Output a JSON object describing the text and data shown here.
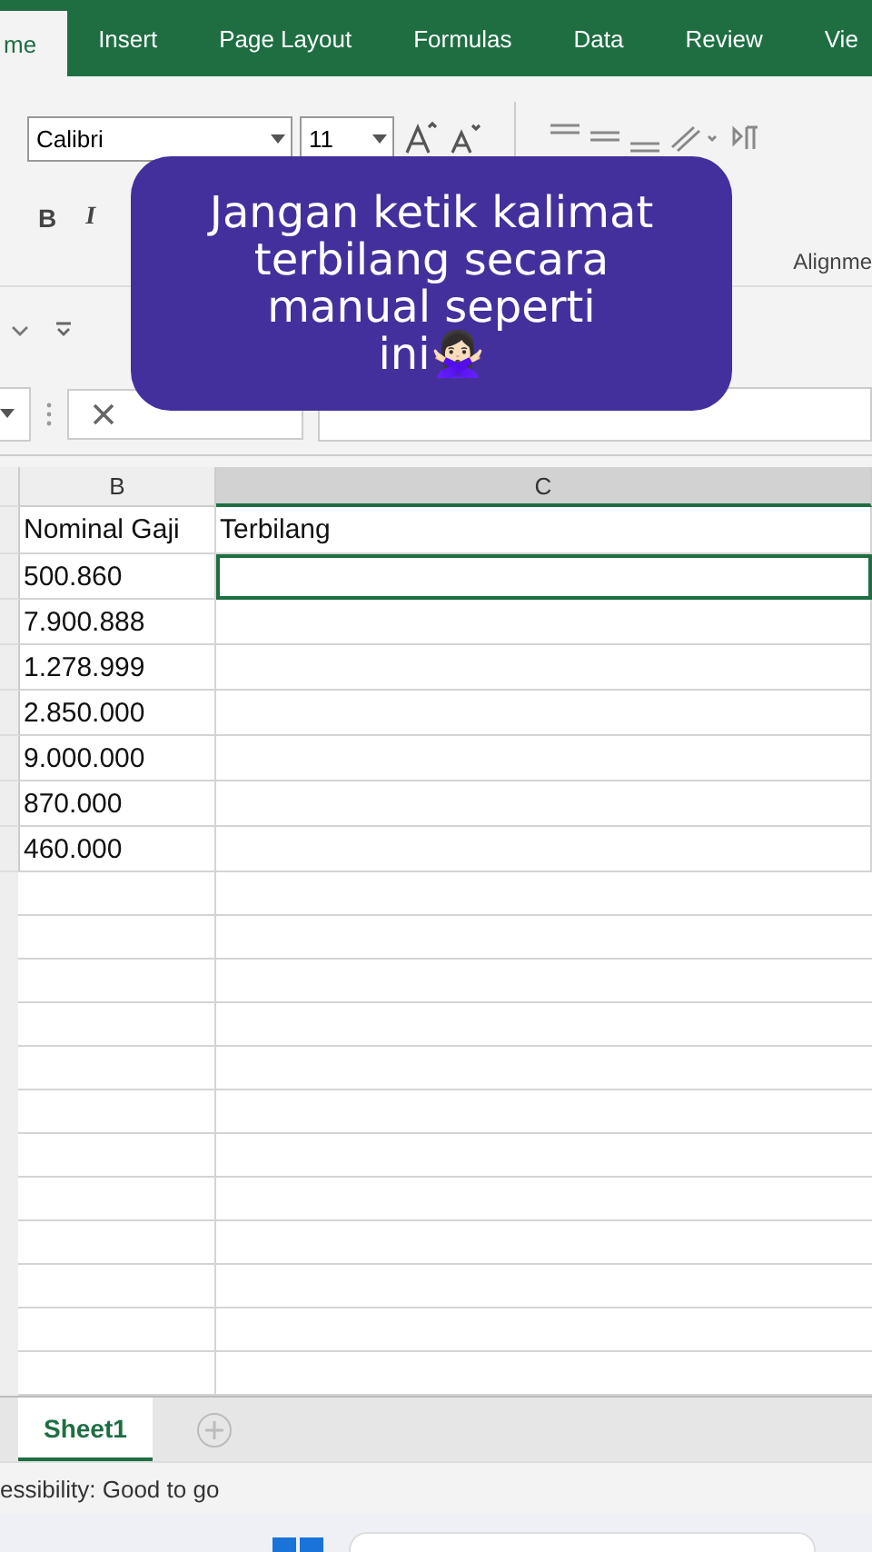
{
  "ribbon_tabs": [
    {
      "label": "me",
      "selected": true
    },
    {
      "label": "Insert",
      "selected": false
    },
    {
      "label": "Page Layout",
      "selected": false
    },
    {
      "label": "Formulas",
      "selected": false
    },
    {
      "label": "Data",
      "selected": false
    },
    {
      "label": "Review",
      "selected": false
    },
    {
      "label": "Vie",
      "selected": false
    }
  ],
  "ribbon": {
    "font": "Calibri",
    "size": "11",
    "bold": "B",
    "italic": "I",
    "group_label": "Alignme"
  },
  "caption": {
    "lines": [
      "Jangan ketik kalimat",
      "terbilang secara",
      "manual seperti",
      "ini🙅🏻‍♀️"
    ]
  },
  "sheet": {
    "columns": [
      {
        "label": "B",
        "selected": false
      },
      {
        "label": "C",
        "selected": true
      }
    ],
    "rows": [
      {
        "b": "Nominal Gaji",
        "c": "Terbilang",
        "selected": false
      },
      {
        "b": "500.860",
        "selected": true
      },
      {
        "b": "7.900.888",
        "selected": false
      },
      {
        "b": "1.278.999",
        "selected": false
      },
      {
        "b": "2.850.000",
        "selected": false
      },
      {
        "b": "9.000.000",
        "selected": false
      },
      {
        "b": "870.000",
        "selected": false
      },
      {
        "b": "460.000",
        "selected": false
      }
    ]
  },
  "sheet_tabs": [
    {
      "label": "Sheet1",
      "selected": true
    }
  ],
  "status_bar": "essibility: Good to go"
}
